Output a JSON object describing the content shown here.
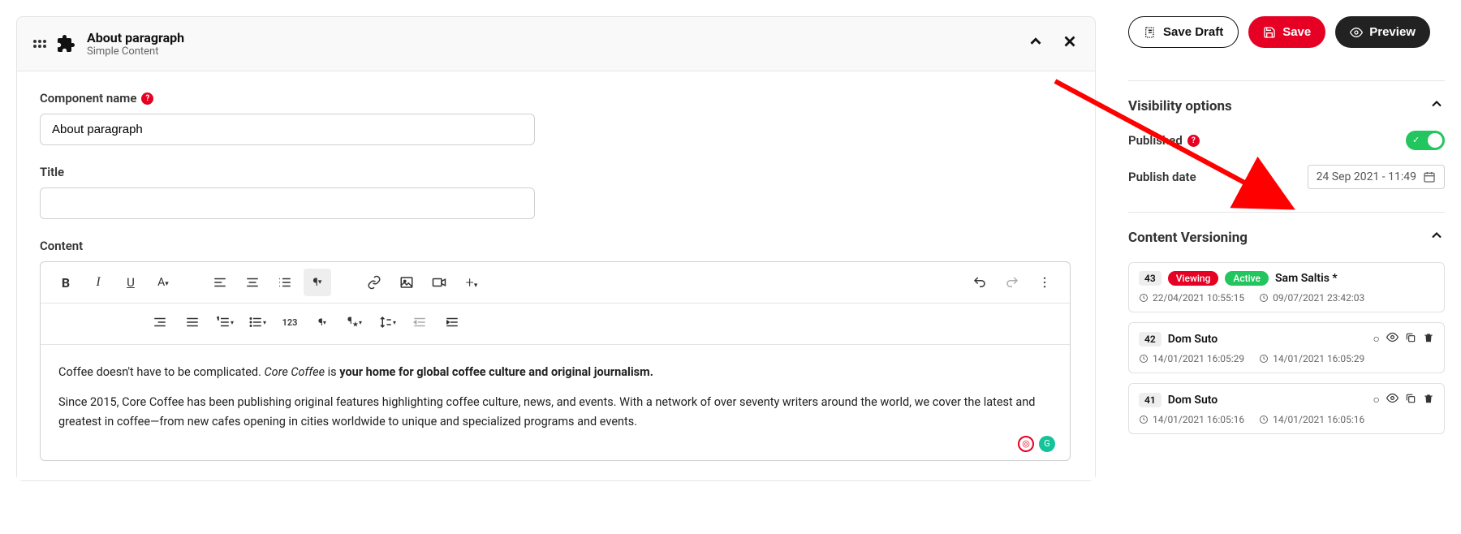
{
  "component": {
    "title": "About paragraph",
    "subtitle": "Simple Content"
  },
  "fields": {
    "component_name_label": "Component name",
    "component_name_value": "About paragraph",
    "title_label": "Title",
    "title_value": "",
    "content_label": "Content"
  },
  "editor": {
    "p1_prefix": "Coffee doesn't have to be complicated. ",
    "p1_em": "Core Coffee",
    "p1_mid": " is ",
    "p1_bold": "your home for global coffee culture and original journalism.",
    "p2": "Since 2015, Core Coffee has been publishing original features highlighting coffee culture, news, and events. With a network of over seventy writers around the world, we cover the latest and greatest in coffee—from new cafes opening in cities worldwide to unique and specialized programs and events."
  },
  "buttons": {
    "save_draft": "Save Draft",
    "save": "Save",
    "preview": "Preview"
  },
  "visibility": {
    "section_title": "Visibility options",
    "published_label": "Published",
    "publish_date_label": "Publish date",
    "publish_date_value": "24 Sep 2021 - 11:49"
  },
  "versioning": {
    "section_title": "Content Versioning",
    "items": [
      {
        "num": "43",
        "badges": [
          "Viewing",
          "Active"
        ],
        "name": "Sam Saltis *",
        "created": "22/04/2021 10:55:15",
        "modified": "09/07/2021 23:42:03",
        "actions": false
      },
      {
        "num": "42",
        "badges": [],
        "name": "Dom Suto",
        "created": "14/01/2021 16:05:29",
        "modified": "14/01/2021 16:05:29",
        "actions": true
      },
      {
        "num": "41",
        "badges": [],
        "name": "Dom Suto",
        "created": "14/01/2021 16:05:16",
        "modified": "14/01/2021 16:05:16",
        "actions": true
      }
    ]
  }
}
